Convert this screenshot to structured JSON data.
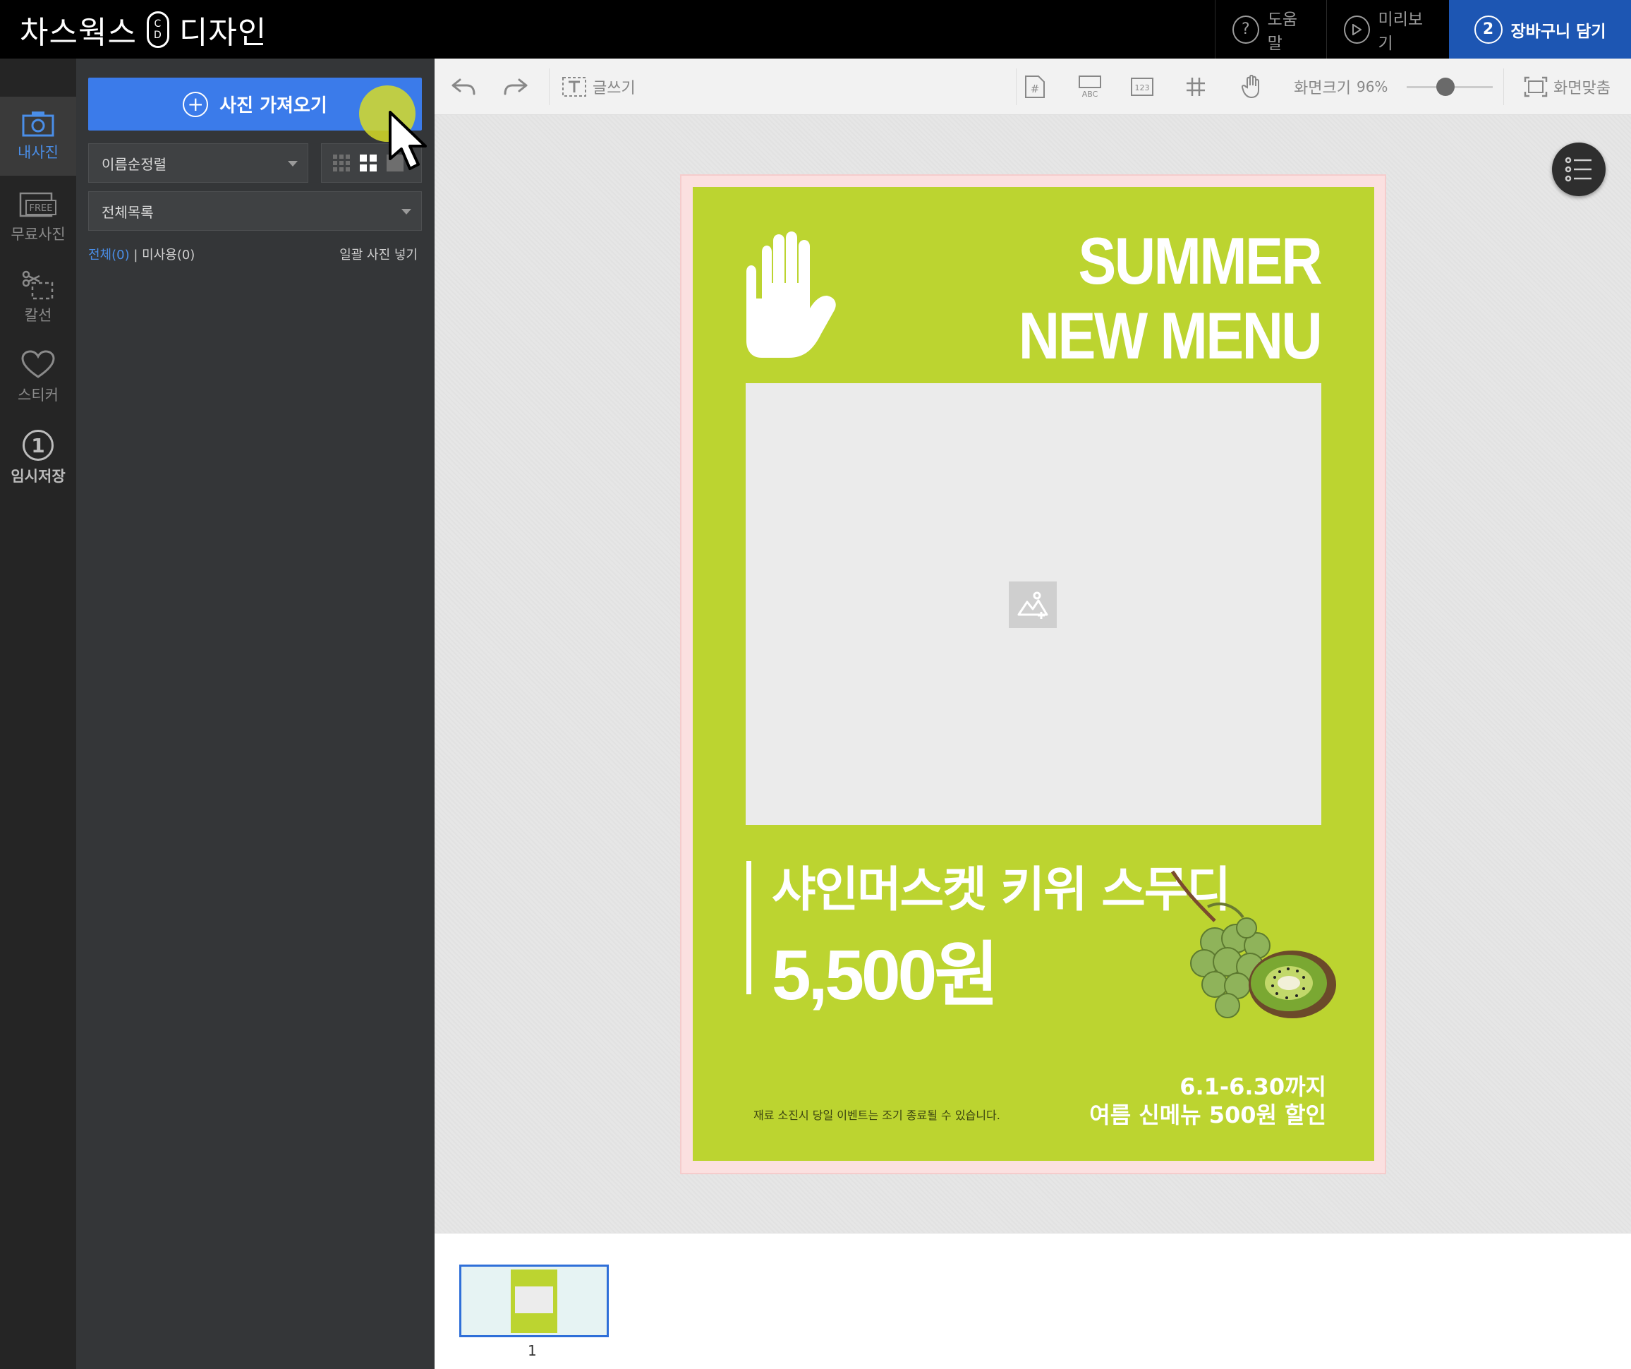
{
  "app": {
    "title": "차스웍스",
    "subtitle": "디자인",
    "logo_top": "C",
    "logo_bottom": "D"
  },
  "topnav": {
    "help": "도움말",
    "preview": "미리보기",
    "cart_step": "2",
    "cart": "장바구니 담기"
  },
  "rail": {
    "my_photos": "내사진",
    "free_photos": "무료사진",
    "cutline": "칼선",
    "sticker": "스티커",
    "temp_step": "1",
    "temp_save": "임시저장"
  },
  "panel": {
    "import_button": "사진 가져오기",
    "sort_value": "이름순정렬",
    "list_value": "전체목록",
    "count_all": "전체(0)",
    "count_divider": " | ",
    "count_unused": "미사용(0)",
    "bulk_insert": "일괄 사진 넣기"
  },
  "toolbar": {
    "write_text": "글쓰기",
    "zoom_label": "화면크기",
    "zoom_value": "96%",
    "zoom_level": 0.45,
    "fit_screen": "화면맞춤"
  },
  "poster": {
    "headline_line1": "SUMMER",
    "headline_line2": "NEW MENU",
    "product_name": "샤인머스켓 키위 스무디",
    "price": "5,500원",
    "period": "6.1-6.30까지",
    "promo": "여름 신메뉴 500원 할인",
    "disclaimer": "재료 소진시 당일 이벤트는 조기 종료될 수 있습니다.",
    "bg_color": "#bcd430"
  },
  "pages": {
    "current_number": "1"
  },
  "colors": {
    "accent": "#3b7bea",
    "cart_bg": "#1d56b3",
    "poster_green": "#bcd430",
    "highlight": "#4a8ee8"
  }
}
